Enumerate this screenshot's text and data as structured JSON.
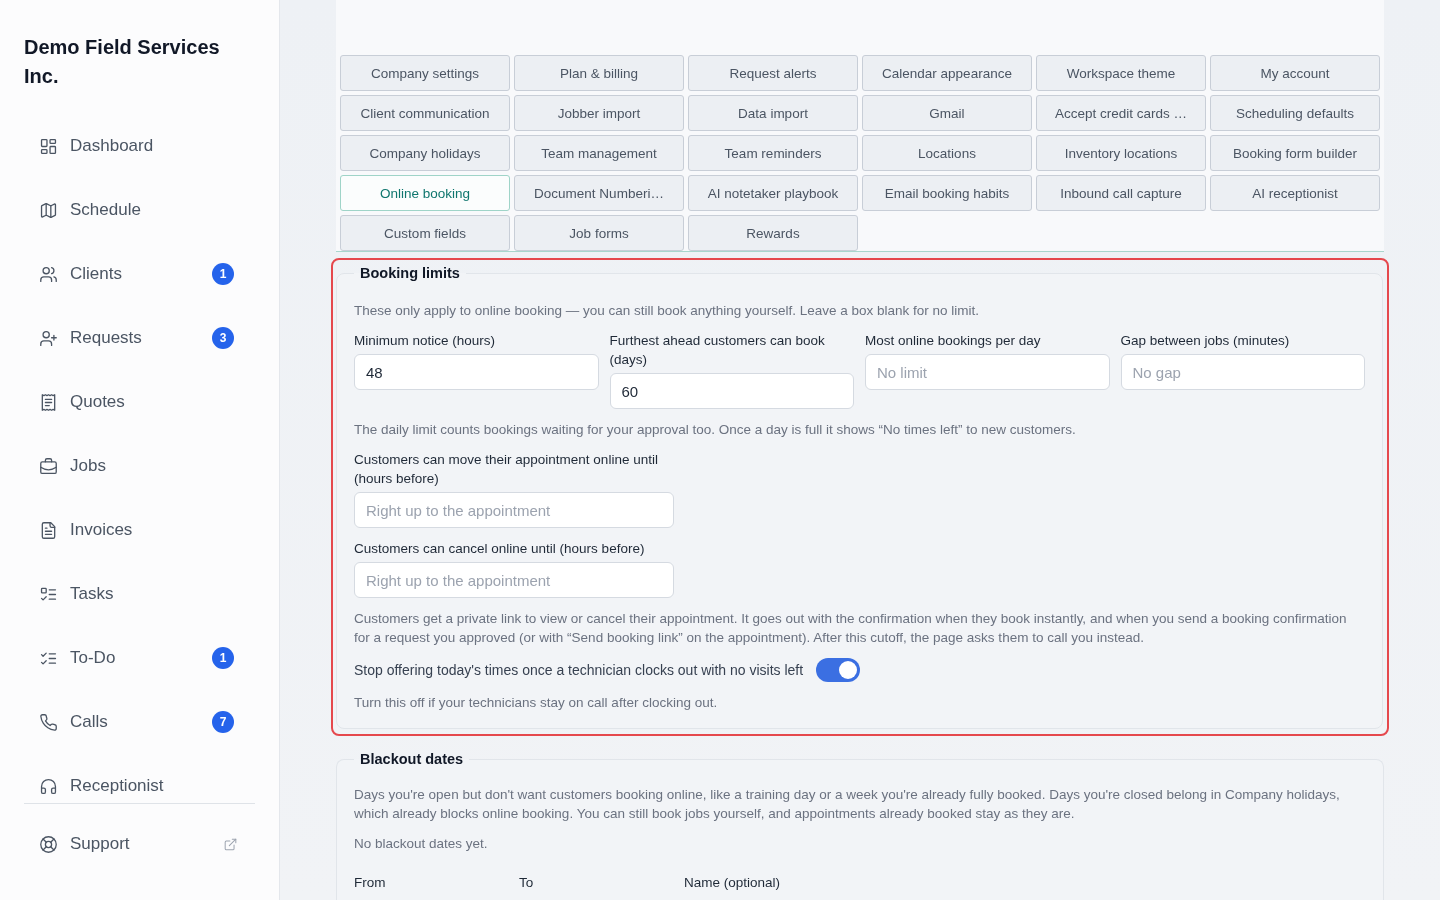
{
  "sidebar": {
    "company_name": "Demo Field Services Inc.",
    "nav_items": [
      {
        "label": "Dashboard"
      },
      {
        "label": "Schedule"
      },
      {
        "label": "Clients",
        "badge": "1"
      },
      {
        "label": "Requests",
        "badge": "3"
      },
      {
        "label": "Quotes"
      },
      {
        "label": "Jobs"
      },
      {
        "label": "Invoices"
      },
      {
        "label": "Tasks"
      },
      {
        "label": "To-Do",
        "badge": "1"
      },
      {
        "label": "Calls",
        "badge": "7"
      },
      {
        "label": "Receptionist"
      }
    ],
    "footer_item": {
      "label": "Support"
    }
  },
  "settings_tabs": [
    {
      "label": "Company settings",
      "selected": false
    },
    {
      "label": "Plan & billing",
      "selected": false
    },
    {
      "label": "Request alerts",
      "selected": false
    },
    {
      "label": "Calendar appearance",
      "selected": false
    },
    {
      "label": "Workspace theme",
      "selected": false
    },
    {
      "label": "My account",
      "selected": false
    },
    {
      "label": "Client communication",
      "selected": false
    },
    {
      "label": "Jobber import",
      "selected": false
    },
    {
      "label": "Data import",
      "selected": false
    },
    {
      "label": "Gmail",
      "selected": false
    },
    {
      "label": "Accept credit cards …",
      "selected": false
    },
    {
      "label": "Scheduling defaults",
      "selected": false
    },
    {
      "label": "Company holidays",
      "selected": false
    },
    {
      "label": "Team management",
      "selected": false
    },
    {
      "label": "Team reminders",
      "selected": false
    },
    {
      "label": "Locations",
      "selected": false
    },
    {
      "label": "Inventory locations",
      "selected": false
    },
    {
      "label": "Booking form builder",
      "selected": false
    },
    {
      "label": "Online booking",
      "selected": true
    },
    {
      "label": "Document Numberi…",
      "selected": false
    },
    {
      "label": "AI notetaker playbook",
      "selected": false
    },
    {
      "label": "Email booking habits",
      "selected": false
    },
    {
      "label": "Inbound call capture",
      "selected": false
    },
    {
      "label": "AI receptionist",
      "selected": false
    },
    {
      "label": "Custom fields",
      "selected": false
    },
    {
      "label": "Job forms",
      "selected": false
    },
    {
      "label": "Rewards",
      "selected": false
    }
  ],
  "booking_limits": {
    "title": "Booking limits",
    "highlighted": true,
    "intro": "These only apply to online booking — you can still book anything yourself. Leave a box blank for no limit.",
    "fields": [
      {
        "label": "Minimum notice (hours)",
        "value": "48"
      },
      {
        "label": "Furthest ahead customers can book (days)",
        "value": "60"
      },
      {
        "label": "Most online bookings per day",
        "placeholder": "No limit"
      },
      {
        "label": "Gap between jobs (minutes)",
        "placeholder": "No gap"
      }
    ],
    "daily_note": "The daily limit counts bookings waiting for your approval too. Once a day is full it shows “No times left” to new customers.",
    "cutoff_fields": [
      {
        "label": "Customers can move their appointment online until (hours before)",
        "placeholder": "Right up to the appointment"
      },
      {
        "label": "Customers can cancel online until (hours before)",
        "placeholder": "Right up to the appointment"
      }
    ],
    "link_note": "Customers get a private link to view or cancel their appointment. It goes out with the confirmation when they book instantly, and when you send a booking confirmation for a request you approved (or with “Send booking link” on the appointment). After this cutoff, the page asks them to call you instead.",
    "toggle": {
      "label": "Stop offering today's times once a technician clocks out with no visits left",
      "on": true
    },
    "toggle_note": "Turn this off if your technicians stay on call after clocking out."
  },
  "blackout_dates": {
    "title": "Blackout dates",
    "intro": "Days you're open but don't want customers booking online, like a training day or a week you're already fully booked. Days you're closed belong in Company holidays, which already blocks online booking. You can still book jobs yourself, and appointments already booked stay as they are.",
    "empty_text": "No blackout dates yet.",
    "form_labels": [
      "From",
      "To",
      "Name (optional)"
    ]
  }
}
